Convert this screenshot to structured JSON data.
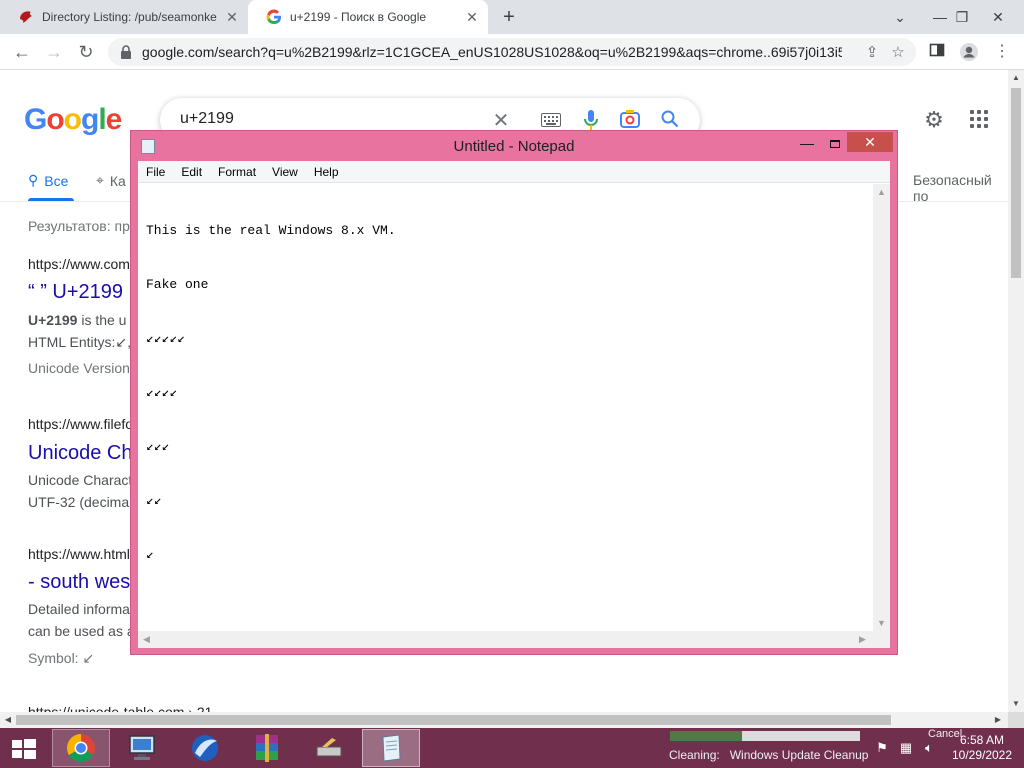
{
  "browser": {
    "tabs": [
      {
        "title": "Directory Listing: /pub/seamonke"
      },
      {
        "title": "u+2199 - Поиск в Google"
      }
    ],
    "omnibox": {
      "url": "google.com/search?q=u%2B2199&rlz=1C1GCEA_enUS1028US1028&oq=u%2B2199&aqs=chrome..69i57j0i13i5..."
    }
  },
  "google": {
    "logo": "Google",
    "search_query": "u+2199",
    "tabs": [
      {
        "label": "Все"
      },
      {
        "label": "Ка"
      },
      {
        "label": "Безопасный по"
      }
    ],
    "results_stats": "Результатов: пр",
    "results": [
      {
        "url": "https://www.com",
        "title": "“ ” U+2199",
        "snippet_bold": "U+2199",
        "snippet": " is the u",
        "snippet2": "HTML Entitys:↙,",
        "meta": "Unicode Version"
      },
      {
        "url": "https://www.filefo",
        "title": "Unicode Ch",
        "snippet": "Unicode Charact",
        "snippet2": "UTF-32 (decima"
      },
      {
        "url": "https://www.html",
        "title": "- south wes",
        "snippet": "Detailed informa",
        "snippet2": "can be used as a",
        "meta": "Symbol: ↙"
      },
      {
        "url": "https://unicode-table.com › 21..."
      }
    ]
  },
  "notepad": {
    "title": "Untitled - Notepad",
    "menu": [
      "File",
      "Edit",
      "Format",
      "View",
      "Help"
    ],
    "lines": [
      "This is the real Windows 8.x VM.",
      "Fake one",
      "↙↙↙↙↙",
      "↙↙↙↙",
      "↙↙↙",
      "↙↙",
      "↙"
    ]
  },
  "taskbar": {
    "cleanup_label": "Cleaning:",
    "cleanup_item": "Windows Update Cleanup",
    "cleanup_progress": 0.38,
    "cancel_label": "Cancel",
    "time": "6:58 AM",
    "date": "10/29/2022"
  }
}
